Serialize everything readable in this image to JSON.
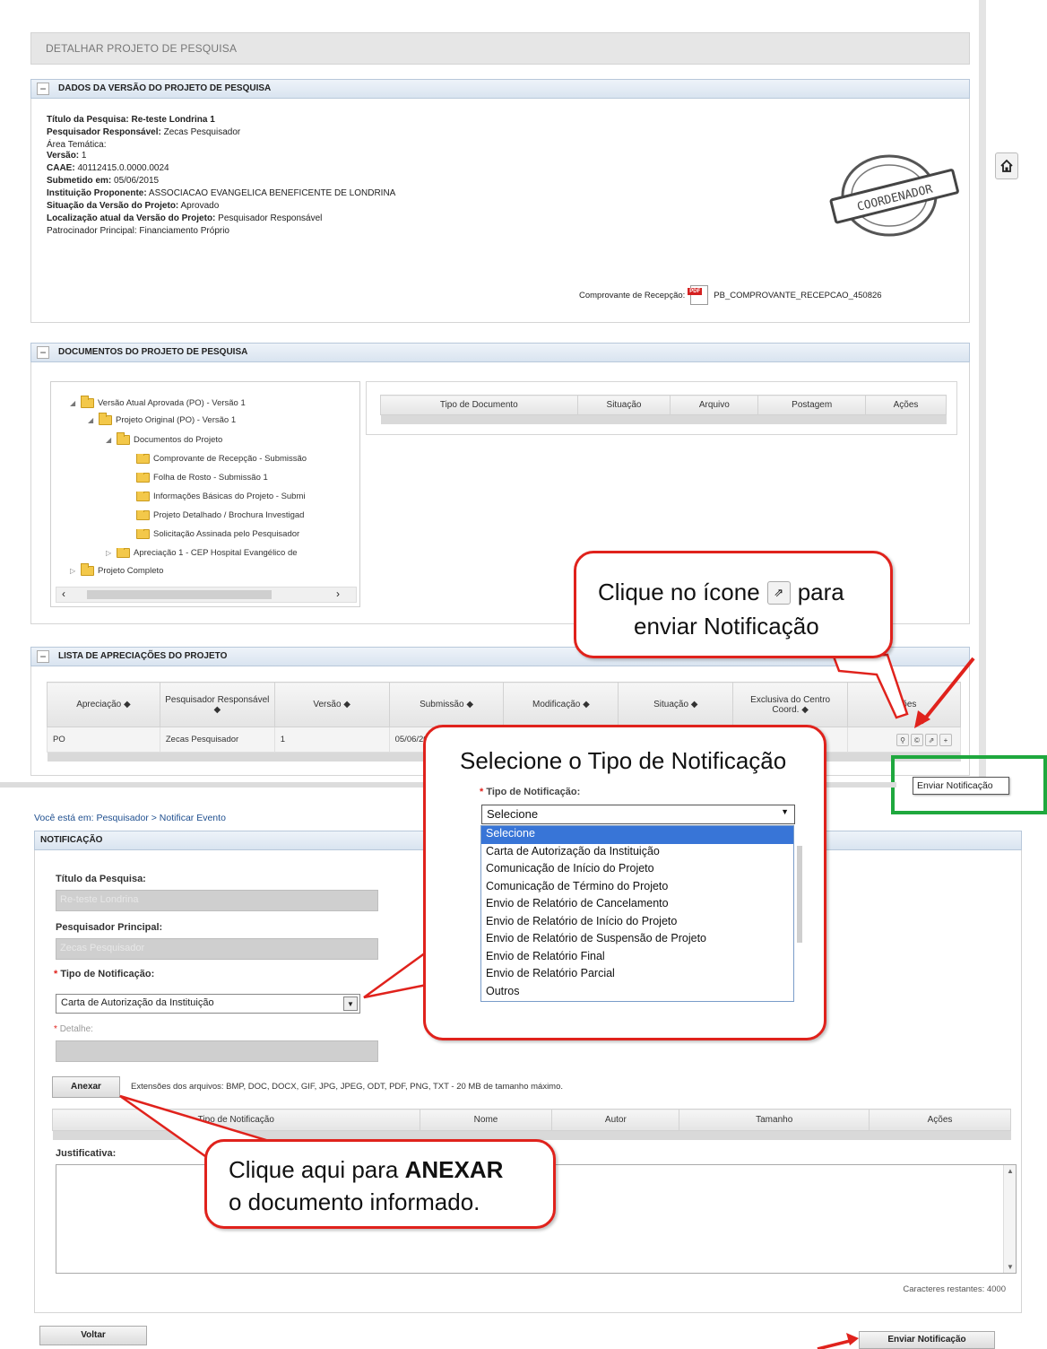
{
  "top": {
    "page_title": "DETALHAR PROJETO DE PESQUISA",
    "panel_dados": {
      "title": "DADOS DA VERSÃO DO PROJETO DE PESQUISA",
      "titulo_label": "Título da Pesquisa:",
      "titulo_value": "Re-teste Londrina 1",
      "pesquisador_label": "Pesquisador Responsável:",
      "pesquisador_value": "Zecas Pesquisador",
      "area_label": "Área Temática:",
      "area_value": "",
      "versao_label": "Versão:",
      "versao_value": "1",
      "caae_label": "CAAE:",
      "caae_value": "40112415.0.0000.0024",
      "submetido_label": "Submetido em:",
      "submetido_value": "05/06/2015",
      "instituicao_label": "Instituição Proponente:",
      "instituicao_value": "ASSOCIACAO EVANGELICA BENEFICENTE DE LONDRINA",
      "situacao_label": "Situação da Versão do Projeto:",
      "situacao_value": "Aprovado",
      "localizacao_label": "Localização atual da Versão do Projeto:",
      "localizacao_value": "Pesquisador Responsável",
      "patrocinador_label": "Patrocinador Principal:",
      "patrocinador_value": "Financiamento Próprio",
      "comprovante_label": "Comprovante de Recepção:",
      "comprovante_file": "PB_COMPROVANTE_RECEPCAO_450826",
      "stamp_text": "COORDENADOR"
    },
    "panel_documentos": {
      "title": "DOCUMENTOS DO PROJETO DE PESQUISA",
      "tree": [
        "Versão Atual Aprovada (PO) - Versão 1",
        "Projeto Original (PO) - Versão 1",
        "Documentos do Projeto",
        "Comprovante de Recepção - Submissão",
        "Folha de Rosto - Submissão 1",
        "Informações Básicas do Projeto - Submi",
        "Projeto Detalhado / Brochura Investigad",
        "Solicitação Assinada pelo Pesquisador",
        "Apreciação 1 - CEP Hospital Evangélico de",
        "Projeto Completo"
      ],
      "columns": [
        "Tipo de Documento",
        "Situação",
        "Arquivo",
        "Postagem",
        "Ações"
      ]
    },
    "panel_apreciacoes": {
      "title": "LISTA DE APRECIAÇÕES DO PROJETO",
      "columns": [
        "Apreciação ◆",
        "Pesquisador Responsável ◆",
        "Versão ◆",
        "Submissão ◆",
        "Modificação ◆",
        "Situação ◆",
        "Exclusiva do Centro Coord. ◆",
        "Ações"
      ],
      "row": [
        "PO",
        "Zecas Pesquisador",
        "1",
        "05/06/20",
        "",
        "",
        "",
        ""
      ]
    },
    "tooltip": "Enviar Notificação"
  },
  "callouts": {
    "icon_line1": "Clique no ícone",
    "icon_line1b": "para",
    "icon_line2": "enviar Notificação",
    "select_title": "Selecione o Tipo de Notificação",
    "select_label": "Tipo de Notificação:",
    "anexar_line1_pre": "Clique aqui para",
    "anexar_line1_bold": "ANEXAR",
    "anexar_line2": "o documento informado."
  },
  "dropdown": {
    "selected": "Selecione",
    "options": [
      "Selecione",
      "Carta de Autorização da Instituição",
      "Comunicação de Início do Projeto",
      "Comunicação de Término do Projeto",
      "Envio de Relatório de Cancelamento",
      "Envio de Relatório de Início do Projeto",
      "Envio de Relatório de Suspensão de Projeto",
      "Envio de Relatório Final",
      "Envio de Relatório Parcial",
      "Outros"
    ]
  },
  "bottom": {
    "breadcrumb": "Você está em: Pesquisador > Notificar Evento",
    "panel_title": "NOTIFICAÇÃO",
    "titulo_label": "Título da Pesquisa:",
    "titulo_value": "Re-teste Londrina",
    "pesquisador_label": "Pesquisador Principal:",
    "pesquisador_value": "Zecas Pesquisador",
    "tipo_label": "Tipo de Notificação:",
    "tipo_value": "Carta de Autorização da Instituição",
    "detalhe_label": "Detalhe:",
    "anexar_button": "Anexar",
    "extensions_text": "Extensões dos arquivos: BMP, DOC, DOCX, GIF, JPG, JPEG, ODT, PDF, PNG, TXT - 20 MB de tamanho máximo.",
    "attach_columns": [
      "Tipo de Notificação",
      "Nome",
      "Autor",
      "Tamanho",
      "Ações"
    ],
    "justificativa_label": "Justificativa:",
    "chars_remaining": "Caracteres restantes: 4000",
    "voltar_button": "Voltar",
    "enviar_button": "Enviar Notificação"
  },
  "colors": {
    "callout_border": "#e0221c",
    "highlight_frame": "#1fa83e",
    "dropdown_selected": "#3875d7"
  }
}
